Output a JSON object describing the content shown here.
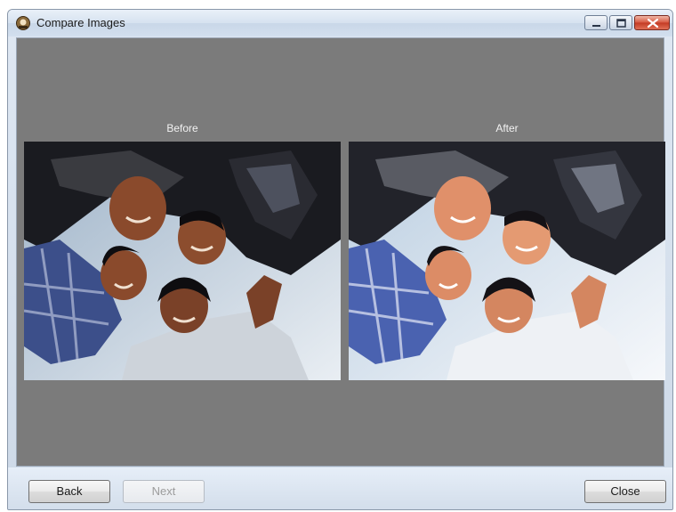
{
  "window": {
    "title": "Compare Images",
    "icon": "scanner-app-icon",
    "controls": [
      "minimize-icon",
      "maximize-icon",
      "close-icon"
    ]
  },
  "compare": {
    "before_label": "Before",
    "after_label": "After"
  },
  "buttons": {
    "back": "Back",
    "next": "Next",
    "next_enabled": false,
    "close": "Close"
  },
  "colors": {
    "content_bg": "#7b7b7b",
    "titlebar": "#d6e2f0",
    "close_button": "#c23a24"
  }
}
